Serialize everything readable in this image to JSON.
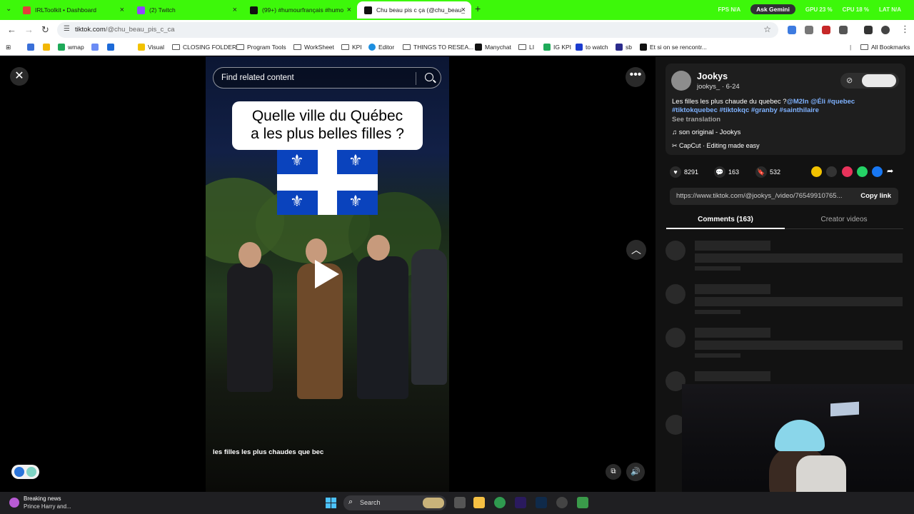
{
  "browser": {
    "tabs": [
      {
        "title": "IRLToolkit • Dashboard",
        "color": "#e2403a"
      },
      {
        "title": "(2) Twitch",
        "color": "#9146ff"
      },
      {
        "title": "(99+) #humourfrançais #humo",
        "color": "#111111"
      },
      {
        "title": "Chu beau pis c ça (@chu_beau_",
        "color": "#111111"
      }
    ],
    "hud": {
      "fps": "FPS N/A",
      "gemini": "Ask Gemini",
      "gpu": "GPU 23 %",
      "cpu": "CPU 18 %",
      "lat": "LAT N/A"
    },
    "url_domain": "tiktok.com",
    "url_path": "/@chu_beau_pis_c_ca",
    "bookmarks": [
      "wmap",
      "Visual",
      "CLOSING FOLDER",
      "Program Tools",
      "WorkSheet",
      "KPI",
      "Editor",
      "THINGS TO RESEA...",
      "Manychat",
      "LI",
      "IG KPI",
      "to watch",
      "sb",
      "Et si on se rencontr...",
      "All Bookmarks"
    ]
  },
  "video": {
    "search_placeholder": "Find related content",
    "caption_line1": "Quelle ville du Québec",
    "caption_line2": "a les plus belles filles ?",
    "subtitle": "les filles les plus chaudes que bec"
  },
  "post": {
    "author_name": "Jookys",
    "author_handle": "jookys_",
    "date": "6-24",
    "desc_text": "Les filles les plus chaude du quebec ?",
    "mentions": "@M2ln @Éli #quebec",
    "tags": "#tiktokquebec #tiktokqc #granby #sainthilaire",
    "see_translation": "See translation",
    "music": "son original - Jookys",
    "capcut": "CapCut · Editing made easy",
    "likes": "8291",
    "comments": "163",
    "saves": "532",
    "link": "https://www.tiktok.com/@jookys_/video/76549910765...",
    "copy_link": "Copy link",
    "tab_comments": "Comments (163)",
    "tab_creator": "Creator videos"
  },
  "taskbar": {
    "news_title": "Breaking news",
    "news_sub": "Prince Harry and...",
    "search": "Search"
  }
}
